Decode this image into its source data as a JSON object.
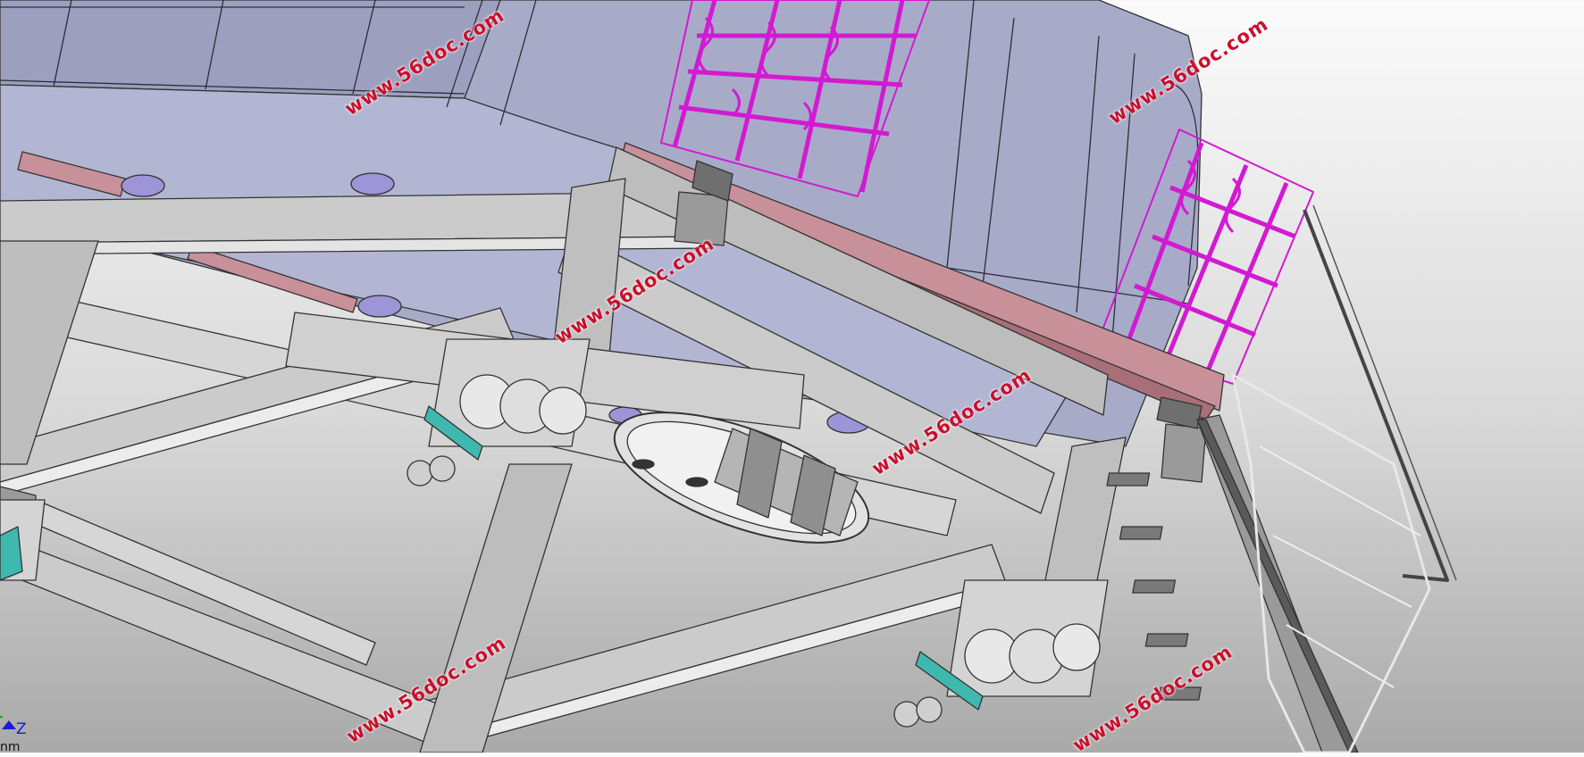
{
  "watermark": "www.56doc.com",
  "triad": {
    "axis_label": "Z",
    "unit_fragment": "nm"
  },
  "colors": {
    "frame_steel": "#c9c9c9",
    "frame_edge": "#333333",
    "container_body": "#a8abc8",
    "container_panel": "#b3b6d2",
    "ornamental_grille": "#d21ad2",
    "pink_beam": "#c89098",
    "roller_cyan": "#3fb8b0",
    "clip_lavender": "#9d95d8",
    "axis_blue": "#1a1ad6",
    "watermark_red": "#c8102e"
  },
  "icons": [
    "coordinate-triad-icon"
  ]
}
